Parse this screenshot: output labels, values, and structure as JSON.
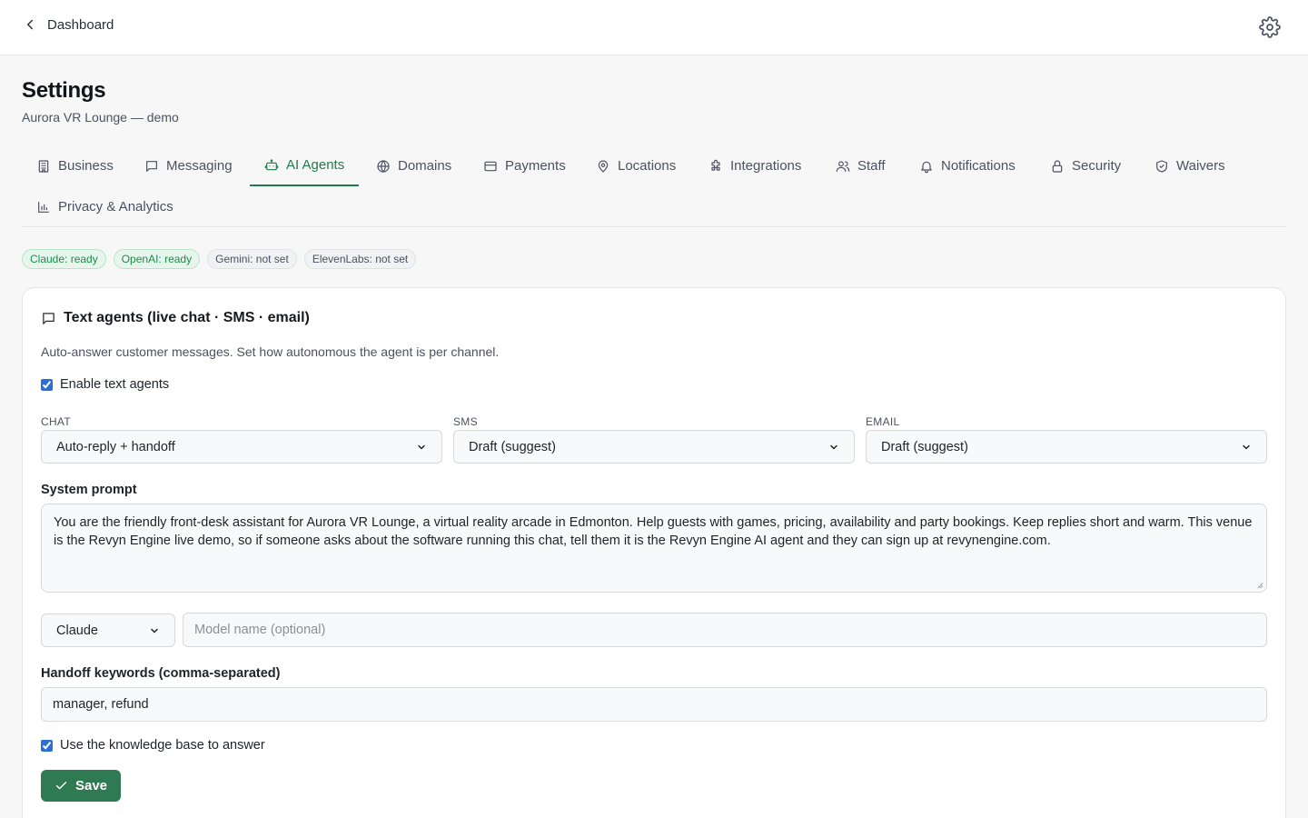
{
  "topbar": {
    "back_label": "Dashboard"
  },
  "header": {
    "title": "Settings",
    "subtitle": "Aurora VR Lounge — demo"
  },
  "tabs": [
    {
      "label": "Business",
      "icon": "building-icon"
    },
    {
      "label": "Messaging",
      "icon": "chat-bubble-icon"
    },
    {
      "label": "AI Agents",
      "icon": "robot-icon",
      "active": true
    },
    {
      "label": "Domains",
      "icon": "globe-icon"
    },
    {
      "label": "Payments",
      "icon": "credit-card-icon"
    },
    {
      "label": "Locations",
      "icon": "map-pin-icon"
    },
    {
      "label": "Integrations",
      "icon": "puzzle-icon"
    },
    {
      "label": "Staff",
      "icon": "users-icon"
    },
    {
      "label": "Notifications",
      "icon": "bell-icon"
    },
    {
      "label": "Security",
      "icon": "lock-icon"
    },
    {
      "label": "Waivers",
      "icon": "shield-check-icon"
    },
    {
      "label": "Privacy & Analytics",
      "icon": "bar-chart-icon"
    }
  ],
  "status_badges": [
    {
      "label": "Claude: ready",
      "state": "ready"
    },
    {
      "label": "OpenAI: ready",
      "state": "ready"
    },
    {
      "label": "Gemini: not set",
      "state": "not set"
    },
    {
      "label": "ElevenLabs: not set",
      "state": "not set"
    }
  ],
  "text_agents": {
    "title": "Text agents (live chat · SMS · email)",
    "description": "Auto-answer customer messages. Set how autonomous the agent is per channel.",
    "enable_label": "Enable text agents",
    "enabled": true,
    "channels": [
      {
        "label": "CHAT",
        "value": "Auto-reply + handoff"
      },
      {
        "label": "SMS",
        "value": "Draft (suggest)"
      },
      {
        "label": "EMAIL",
        "value": "Draft (suggest)"
      }
    ],
    "system_prompt_label": "System prompt",
    "system_prompt": "You are the friendly front-desk assistant for Aurora VR Lounge, a virtual reality arcade in Edmonton. Help guests with games, pricing, availability and party bookings. Keep replies short and warm. This venue is the Revyn Engine live demo, so if someone asks about the software running this chat, tell them it is the Revyn Engine AI agent and they can sign up at revynengine.com.",
    "provider": "Claude",
    "model_placeholder": "Model name (optional)",
    "handoff_label": "Handoff keywords (comma-separated)",
    "handoff_value": "manager, refund",
    "kb_label": "Use the knowledge base to answer",
    "kb_enabled": true,
    "save_label": "Save"
  },
  "colors": {
    "accent": "#1f7a4c",
    "save_button": "#2f7a53",
    "ready_badge_bg": "#e6f6ec",
    "ready_badge_text": "#1f8a4c",
    "neutral_badge_bg": "#f1f2f4"
  }
}
